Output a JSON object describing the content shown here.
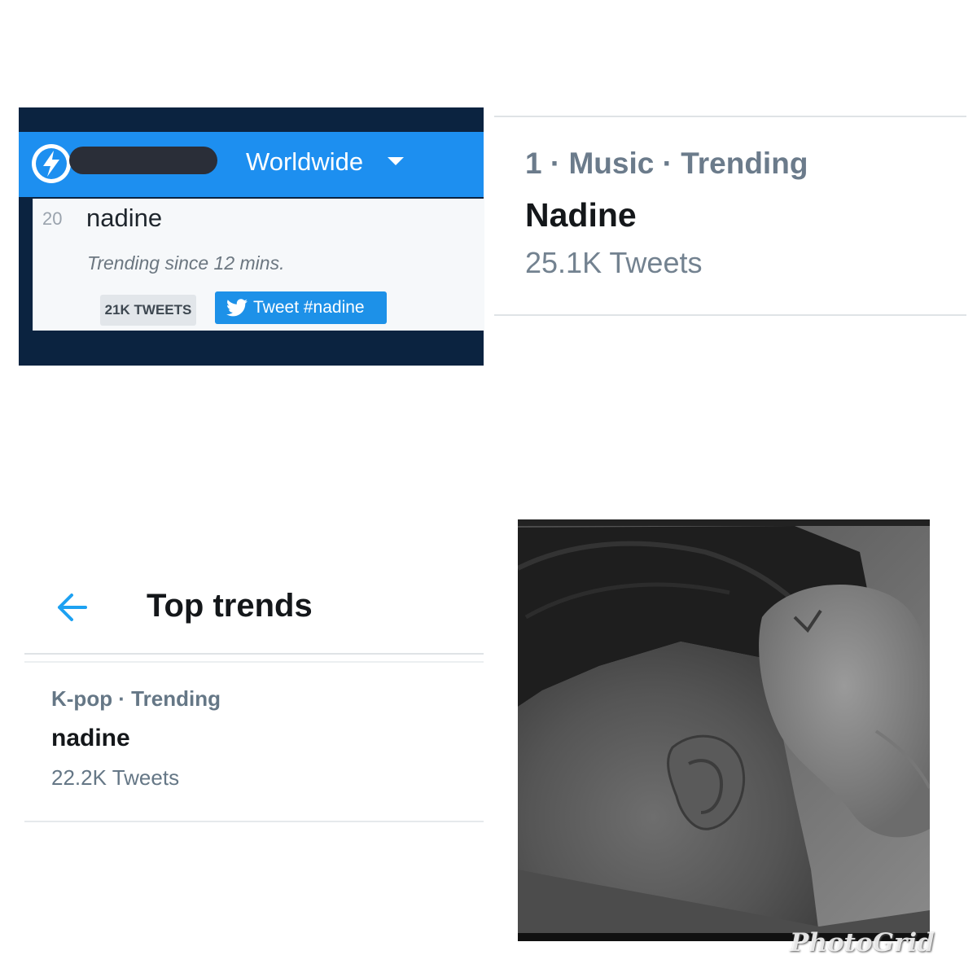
{
  "panel_trends_widget": {
    "logo_icon": "lightning-bolt-icon",
    "location": "Worldwide",
    "dropdown_icon": "caret-down-icon",
    "rank": "20",
    "trend_name": "nadine",
    "trending_since": "Trending since 12 mins.",
    "tweet_count_badge": "21K TWEETS",
    "tweet_button_label": "Tweet #nadine",
    "tweet_button_icon": "twitter-bird-icon",
    "colors": {
      "bar": "#1d8ff0",
      "frame": "#0b2340",
      "button": "#1d91e8"
    }
  },
  "panel_music_trend": {
    "meta": "1 · Music · Trending",
    "name": "Nadine",
    "tweets": "25.1K Tweets"
  },
  "panel_top_trends": {
    "back_icon": "back-arrow-icon",
    "title": "Top trends",
    "meta": "K-pop · Trending",
    "name": "nadine",
    "tweets": "22.2K Tweets"
  },
  "panel_photo": {
    "watermark": "PhotoGrid"
  }
}
